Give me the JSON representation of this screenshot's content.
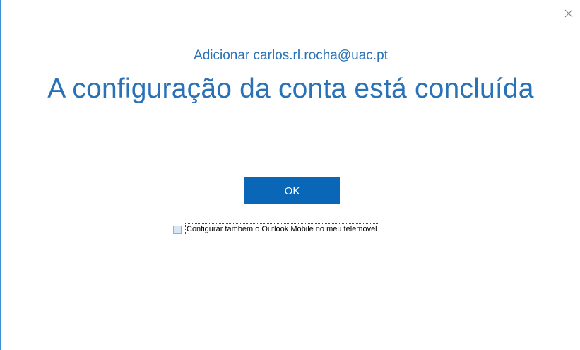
{
  "dialog": {
    "subtitle": "Adicionar carlos.rl.rocha@uac.pt",
    "title": "A configuração da conta está concluída",
    "ok_label": "OK",
    "mobile_option": {
      "label": "Configurar também o Outlook Mobile no meu telemóvel",
      "checked": false
    },
    "close_icon": "close-icon"
  },
  "colors": {
    "accent_text": "#2a72b8",
    "button_bg": "#0a67b8",
    "window_border": "#3f8fd8"
  }
}
